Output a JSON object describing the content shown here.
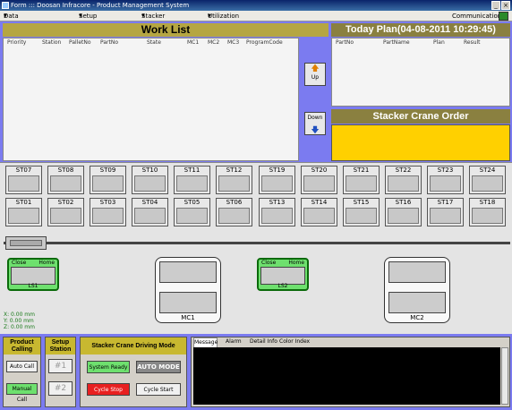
{
  "window": {
    "title": "Form ::: Doosan Infracore - Product Management System"
  },
  "menu": {
    "items": [
      "Data Management",
      "Setup Station",
      "Stacker Crane",
      "Utilization Report"
    ],
    "right": "Communication"
  },
  "worklist": {
    "title": "Work List",
    "columns": [
      "Priority",
      "Station",
      "PalletNo",
      "PartNo",
      "State",
      "MC1",
      "MC2",
      "MC3",
      "ProgramCode"
    ]
  },
  "arrows": {
    "up": "Up",
    "down": "Down"
  },
  "today": {
    "title": "Today Plan(04-08-2011 10:29:45)",
    "columns": [
      "PartNo",
      "PartName",
      "Plan",
      "Result"
    ]
  },
  "stacker_order": {
    "title": "Stacker Crane Order"
  },
  "stations_top": [
    "ST07",
    "ST08",
    "ST09",
    "ST10",
    "ST11",
    "ST12",
    "ST19",
    "ST20",
    "ST21",
    "ST22",
    "ST23",
    "ST24"
  ],
  "stations_bottom": [
    "ST01",
    "ST02",
    "ST03",
    "ST04",
    "ST05",
    "ST06",
    "ST13",
    "ST14",
    "ST15",
    "ST16",
    "ST17",
    "ST18"
  ],
  "ls1": {
    "close": "Close",
    "home": "Home",
    "label": "LS1"
  },
  "ls2": {
    "close": "Close",
    "home": "Home",
    "label": "LS2"
  },
  "mc1": {
    "label": "MC1"
  },
  "mc2": {
    "label": "MC2"
  },
  "coords": {
    "x": "X: 0.00 mm",
    "y": "Y: 0.00 mm",
    "z": "Z: 0.00 mm"
  },
  "product_calling": {
    "title": "Product Calling",
    "auto": "Auto Call",
    "manual": "Manual Call"
  },
  "setup_station": {
    "title": "Setup Station",
    "s1": "#1",
    "s2": "#2"
  },
  "driving": {
    "title": "Stacker Crane Driving Mode",
    "ready": "System Ready",
    "auto": "AUTO MODE",
    "stop": "Cycle Stop",
    "start": "Cycle Start"
  },
  "tabs": [
    "Message",
    "Alarm",
    "Detail Info",
    "Color Index"
  ]
}
